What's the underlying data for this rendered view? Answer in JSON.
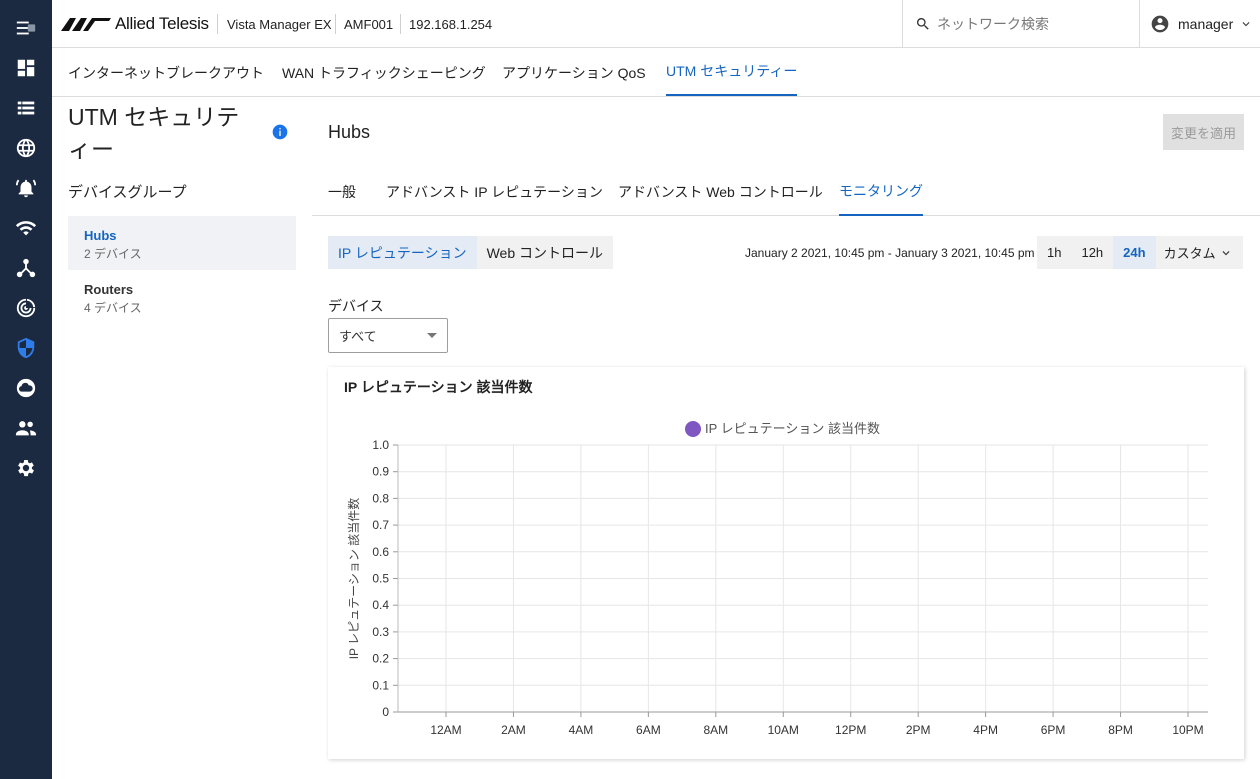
{
  "rail": {
    "items": [
      {
        "icon": "menu-icon"
      },
      {
        "icon": "dashboard-icon"
      },
      {
        "icon": "list-icon"
      },
      {
        "icon": "globe-icon"
      },
      {
        "icon": "alert-bell-icon"
      },
      {
        "icon": "wifi-icon"
      },
      {
        "icon": "network-topology-icon"
      },
      {
        "icon": "radar-icon"
      },
      {
        "icon": "security-shield-icon",
        "active": true
      },
      {
        "icon": "cloud-icon"
      },
      {
        "icon": "users-icon"
      },
      {
        "icon": "settings-gear-icon"
      }
    ]
  },
  "header": {
    "brand": "Allied Telesis",
    "product": "Vista Manager EX",
    "area": "AMF001",
    "ip": "192.168.1.254",
    "search_placeholder": "ネットワーク検索",
    "user": "manager"
  },
  "top_tabs": [
    "インターネットブレークアウト",
    "WAN トラフィックシェーピング",
    "アプリケーション QoS",
    "UTM セキュリティー"
  ],
  "top_tab_active": 3,
  "sidebar": {
    "title": "UTM セキュリティー",
    "group_label": "デバイスグループ",
    "groups": [
      {
        "name": "Hubs",
        "sub": "2 デバイス",
        "active": true
      },
      {
        "name": "Routers",
        "sub": "4 デバイス",
        "active": false
      }
    ]
  },
  "main": {
    "title": "Hubs",
    "apply_label": "変更を適用",
    "tabs": [
      "一般",
      "アドバンスト IP レピュテーション",
      "アドバンスト Web コントロール",
      "モニタリング"
    ],
    "tab_active": 3,
    "segments": [
      "IP レピュテーション",
      "Web コントロール"
    ],
    "segment_active": 0,
    "date_range": "January 2 2021, 10:45 pm - January 3 2021, 10:45 pm",
    "ranges": [
      "1h",
      "12h",
      "24h"
    ],
    "range_active": 2,
    "custom_label": "カスタム",
    "device_label": "デバイス",
    "device_value": "すべて"
  },
  "chart_data": {
    "type": "line",
    "title": "IP レピュテーション 該当件数",
    "ylabel": "IP レピュテーション 該当件数",
    "xlabel": "",
    "legend": "top-center",
    "ylim": [
      0,
      1
    ],
    "yticks": [
      "0",
      "0.1",
      "0.2",
      "0.3",
      "0.4",
      "0.5",
      "0.6",
      "0.7",
      "0.8",
      "0.9",
      "1.0"
    ],
    "xticks": [
      "12AM",
      "2AM",
      "4AM",
      "6AM",
      "8AM",
      "10AM",
      "12PM",
      "2PM",
      "4PM",
      "6PM",
      "8PM",
      "10PM"
    ],
    "grid": true,
    "series": [
      {
        "name": "IP レピュテーション 該当件数",
        "color": "#7e57c2",
        "values": []
      }
    ]
  }
}
